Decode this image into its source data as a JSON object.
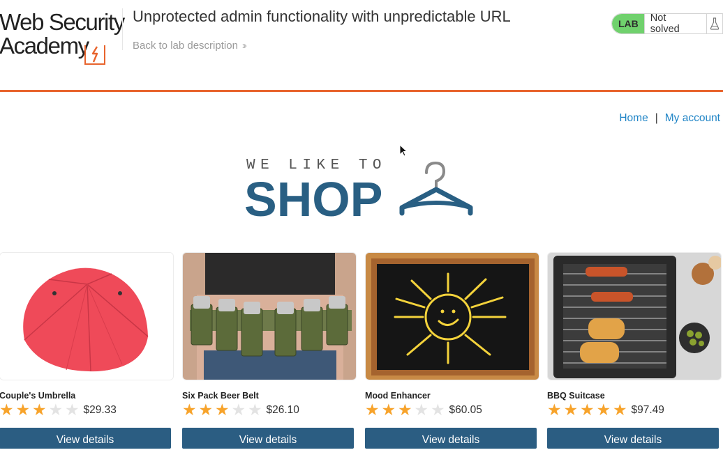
{
  "header": {
    "logo_line1": "Web Security",
    "logo_line2": "Academy",
    "lab_title": "Unprotected admin functionality with unpredictable URL",
    "back_link": "Back to lab description",
    "lab_badge": "LAB",
    "lab_status": "Not solved"
  },
  "nav": {
    "home": "Home",
    "separator": "|",
    "my_account": "My account"
  },
  "banner": {
    "subtitle": "WE LIKE TO",
    "title": "SHOP"
  },
  "colors": {
    "accent_orange": "#e8642d",
    "link_blue": "#1f84c6",
    "brand_blue": "#295f83",
    "button_blue": "#2b5d82",
    "star_gold": "#f7a32b",
    "lab_green": "#70d16d"
  },
  "products": [
    {
      "name": "Couple's Umbrella",
      "rating": 3,
      "price": "$29.33",
      "button": "View details",
      "image_icon": "umbrella-image"
    },
    {
      "name": "Six Pack Beer Belt",
      "rating": 3,
      "price": "$26.10",
      "button": "View details",
      "image_icon": "beer-belt-image"
    },
    {
      "name": "Mood Enhancer",
      "rating": 3,
      "price": "$60.05",
      "button": "View details",
      "image_icon": "sun-chalkboard-image"
    },
    {
      "name": "BBQ Suitcase",
      "rating": 5,
      "price": "$97.49",
      "button": "View details",
      "image_icon": "bbq-grill-image"
    }
  ]
}
